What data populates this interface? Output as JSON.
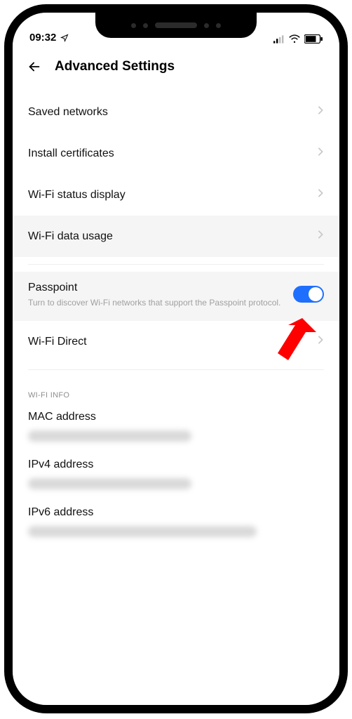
{
  "status": {
    "time": "09:32"
  },
  "header": {
    "title": "Advanced Settings"
  },
  "rows": {
    "saved_networks": "Saved networks",
    "install_certificates": "Install certificates",
    "wifi_status_display": "Wi-Fi status display",
    "wifi_data_usage": "Wi-Fi data usage",
    "passpoint_title": "Passpoint",
    "passpoint_sub": "Turn to discover Wi-Fi networks that support the Passpoint protocol.",
    "passpoint_on": true,
    "wifi_direct": "Wi-Fi Direct"
  },
  "section": {
    "wifi_info": "WI-FI INFO",
    "mac": "MAC address",
    "ipv4": "IPv4 address",
    "ipv6": "IPv6 address"
  }
}
